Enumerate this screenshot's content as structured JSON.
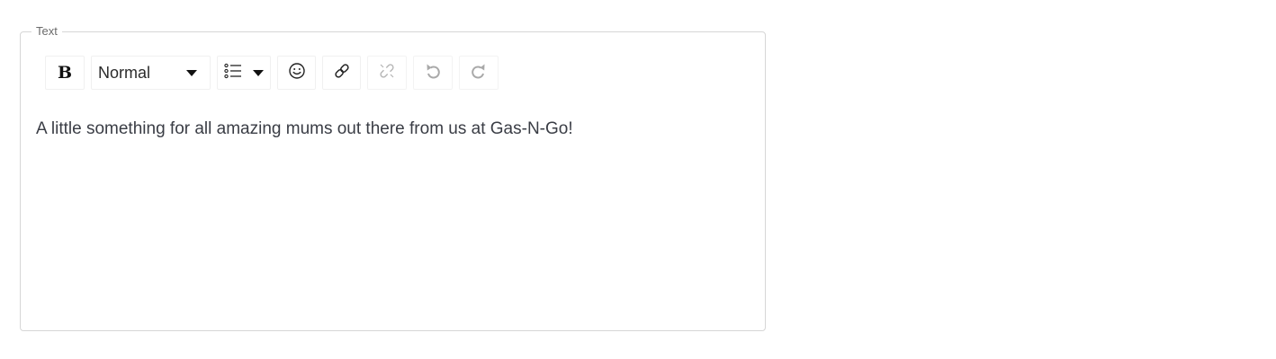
{
  "field": {
    "label": "Text"
  },
  "toolbar": {
    "bold_glyph": "B",
    "block_type": "Normal",
    "icons": [
      "bold-icon",
      "list-icon",
      "emoji-icon",
      "link-icon",
      "unlink-icon",
      "undo-icon",
      "redo-icon"
    ],
    "disabled": [
      "unlink",
      "undo",
      "redo"
    ]
  },
  "editor": {
    "content": "A little something for all amazing mums out there from us at Gas-N-Go!"
  },
  "colors": {
    "border": "#d6d6d6",
    "text": "#3a3d45",
    "disabled_icon": "#b5b5b5"
  }
}
